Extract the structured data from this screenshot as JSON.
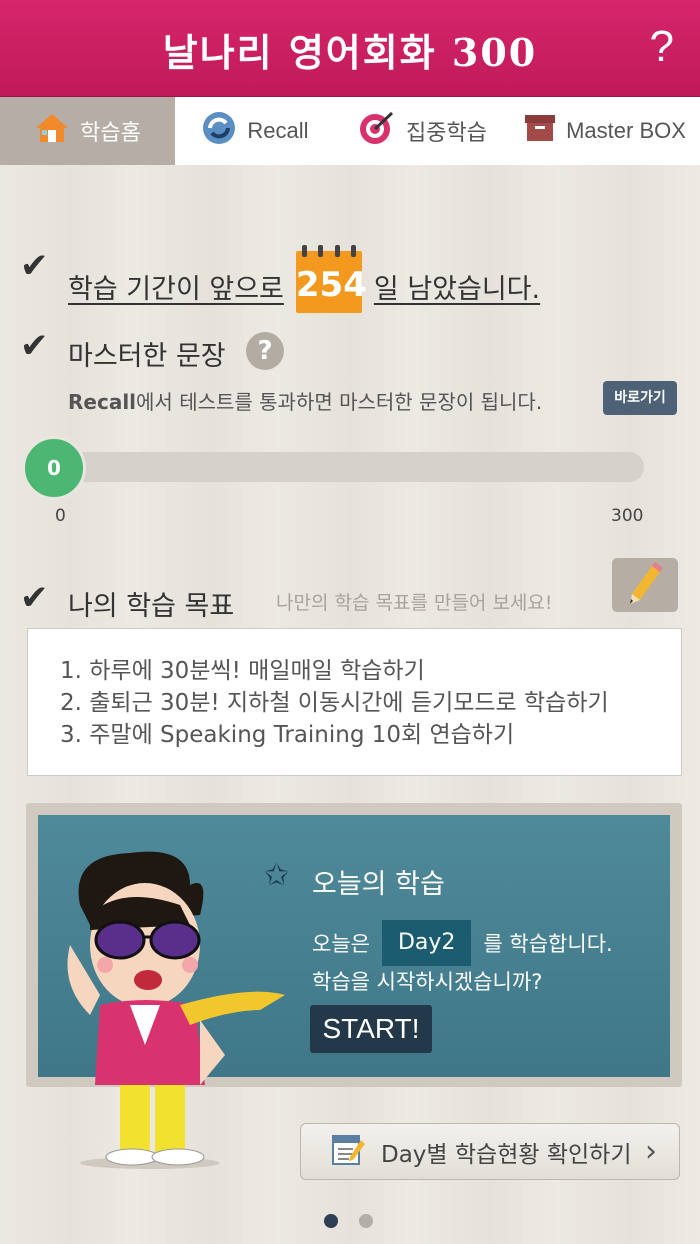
{
  "header": {
    "title": "날나리 영어회화 300",
    "help": "?"
  },
  "tabs": [
    {
      "label": "학습홈",
      "icon": "house-icon",
      "active": true
    },
    {
      "label": "Recall",
      "icon": "recall-arrows-icon",
      "active": false
    },
    {
      "label": "집중학습",
      "icon": "target-icon",
      "active": false
    },
    {
      "label": "Master BOX",
      "icon": "box-icon",
      "active": false
    }
  ],
  "period": {
    "before": "학습 기간이 앞으로",
    "days": "254",
    "after": "일 남았습니다."
  },
  "mastered": {
    "title": "마스터한 문장",
    "help": "?",
    "desc_bold": "Recall",
    "desc_rest": "에서 테스트를 통과하면 마스터한 문장이 됩니다.",
    "goto_label": "바로가기",
    "value": 0,
    "value_label": "0",
    "min_label": "0",
    "max_label": "300",
    "progress": 0
  },
  "goals": {
    "title": "나의 학습 목표",
    "hint": "나만의 학습 목표를 만들어 보세요!",
    "items": [
      "1. 하루에 30분씩! 매일매일 학습하기",
      "2. 출퇴근 30분! 지하철 이동시간에 듣기모드로 학습하기",
      "3. 주말에 Speaking Training 10회 연습하기"
    ]
  },
  "today": {
    "title": "오늘의 학습",
    "prefix": "오늘은",
    "day": "Day2",
    "suffix": "를 학습합니다.",
    "question": "학습을 시작하시겠습니까?",
    "start": "START!"
  },
  "status_button": {
    "label": "Day별 학습현황 확인하기"
  },
  "pager": {
    "total": 2,
    "current": 1
  },
  "colors": {
    "header": "#c81f60",
    "accent_green": "#4cb772",
    "calendar_orange": "#f39a1e",
    "board": "#467f90"
  }
}
